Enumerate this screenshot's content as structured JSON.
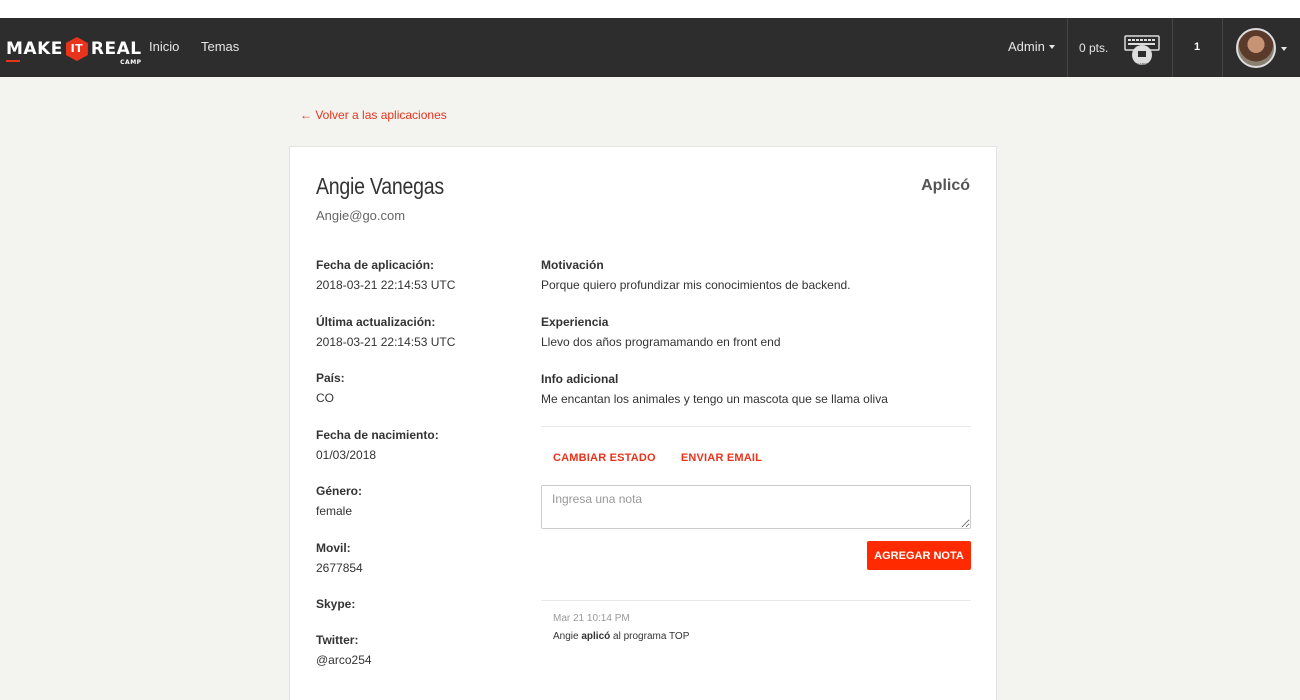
{
  "nav": {
    "logo": {
      "part1": "MAKE",
      "part2": "IT",
      "part3": "REAL",
      "sub": "CAMP"
    },
    "links": [
      "Inicio",
      "Temas"
    ],
    "admin": "Admin",
    "points": "0 pts.",
    "badge_text": "BLANCO",
    "notifications": "1"
  },
  "back_link": "← Volver a las aplicaciones",
  "applicant": {
    "name": "Angie Vanegas",
    "email": "Angie@go.com",
    "status": "Aplicó"
  },
  "info": [
    {
      "label": "Fecha de aplicación:",
      "value": "2018-03-21 22:14:53 UTC"
    },
    {
      "label": "Última actualización:",
      "value": "2018-03-21 22:14:53 UTC"
    },
    {
      "label": "País:",
      "value": "CO"
    },
    {
      "label": "Fecha de nacimiento:",
      "value": "01/03/2018"
    },
    {
      "label": "Género:",
      "value": "female"
    },
    {
      "label": "Movil:",
      "value": "2677854"
    },
    {
      "label": "Skype:",
      "value": ""
    },
    {
      "label": "Twitter:",
      "value": "@arco254"
    }
  ],
  "details": [
    {
      "label": "Motivación",
      "value": "Porque quiero profundizar mis conocimientos de backend."
    },
    {
      "label": "Experiencia",
      "value": "Llevo dos años programamando en front end"
    },
    {
      "label": "Info adicional",
      "value": "Me encantan los animales y tengo un mascota que se llama oliva"
    }
  ],
  "actions": {
    "change_status": "CAMBIAR ESTADO",
    "send_email": "ENVIAR EMAIL"
  },
  "note": {
    "placeholder": "Ingresa una nota",
    "add_button": "AGREGAR NOTA"
  },
  "timeline": [
    {
      "time": "Mar 21 10:14 PM",
      "actor": "Angie",
      "action": "aplicó",
      "suffix": "al programa TOP"
    }
  ],
  "colors": {
    "accent": "#e8341c",
    "button": "#ff2a00",
    "navbar": "#2d2d2d",
    "background": "#f3f3ef"
  }
}
